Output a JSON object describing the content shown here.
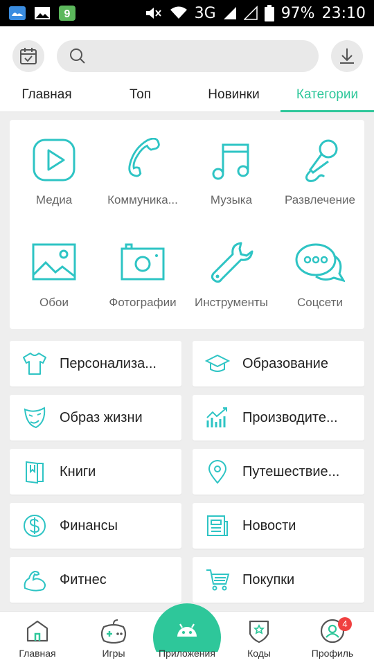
{
  "status_bar": {
    "network": "3G",
    "battery": "97%",
    "time": "23:10"
  },
  "header": {
    "search_placeholder": "",
    "tabs": [
      {
        "label": "Главная"
      },
      {
        "label": "Топ"
      },
      {
        "label": "Новинки"
      },
      {
        "label": "Категории"
      }
    ]
  },
  "categories_grid": [
    {
      "label": "Медиа",
      "icon": "play-icon"
    },
    {
      "label": "Коммуника...",
      "icon": "phone-icon"
    },
    {
      "label": "Музыка",
      "icon": "music-note-icon"
    },
    {
      "label": "Развлечение",
      "icon": "microphone-icon"
    },
    {
      "label": "Обои",
      "icon": "image-icon"
    },
    {
      "label": "Фотографии",
      "icon": "camera-icon"
    },
    {
      "label": "Инструменты",
      "icon": "wrench-icon"
    },
    {
      "label": "Соцсети",
      "icon": "chat-bubble-icon"
    }
  ],
  "categories_list": [
    {
      "label": "Персонализа...",
      "icon": "tshirt-icon"
    },
    {
      "label": "Образование",
      "icon": "graduation-cap-icon"
    },
    {
      "label": "Образ жизни",
      "icon": "mask-icon"
    },
    {
      "label": "Производите...",
      "icon": "chart-icon"
    },
    {
      "label": "Книги",
      "icon": "book-icon"
    },
    {
      "label": "Путешествие...",
      "icon": "location-pin-icon"
    },
    {
      "label": "Финансы",
      "icon": "dollar-icon"
    },
    {
      "label": "Новости",
      "icon": "newspaper-icon"
    },
    {
      "label": "Фитнес",
      "icon": "muscle-icon"
    },
    {
      "label": "Покупки",
      "icon": "cart-icon"
    }
  ],
  "bottom_nav": [
    {
      "label": "Главная",
      "icon": "home-icon"
    },
    {
      "label": "Игры",
      "icon": "gamepad-icon"
    },
    {
      "label": "Приложения",
      "icon": "android-icon"
    },
    {
      "label": "Коды",
      "icon": "shield-star-icon"
    },
    {
      "label": "Профиль",
      "icon": "profile-icon",
      "badge": "4"
    }
  ],
  "colors": {
    "accent": "#2ec79a",
    "icon_teal": "#2ec4c4",
    "badge": "#f04040"
  }
}
